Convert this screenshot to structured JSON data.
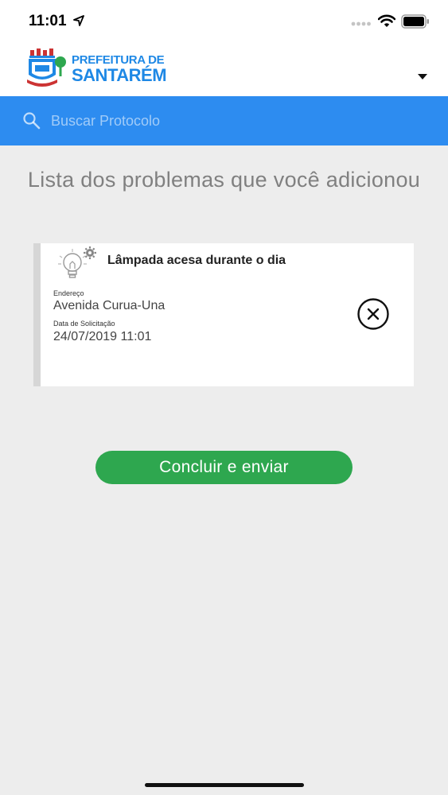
{
  "status_bar": {
    "time": "11:01",
    "icons": [
      "location-arrow-icon",
      "signal-icon",
      "wifi-icon",
      "battery-icon"
    ]
  },
  "header": {
    "logo_line1": "PREFEITURA DE",
    "logo_line2": "SANTARÉM",
    "menu_icon": "chevron-down-icon"
  },
  "search": {
    "placeholder": "Buscar Protocolo",
    "value": ""
  },
  "page": {
    "title": "Lista dos problemas que você adicionou"
  },
  "problems": [
    {
      "icon": "lightbulb-gear-icon",
      "title": "Lâmpada acesa durante o dia",
      "address_label": "Endereço",
      "address": "Avenida Curua-Una",
      "date_label": "Data de Solicitação",
      "date": "24/07/2019 11:01"
    }
  ],
  "actions": {
    "submit_label": "Concluir e enviar"
  },
  "colors": {
    "primary_blue": "#2d8cf0",
    "submit_green": "#2ea74f",
    "background": "#ededed"
  }
}
